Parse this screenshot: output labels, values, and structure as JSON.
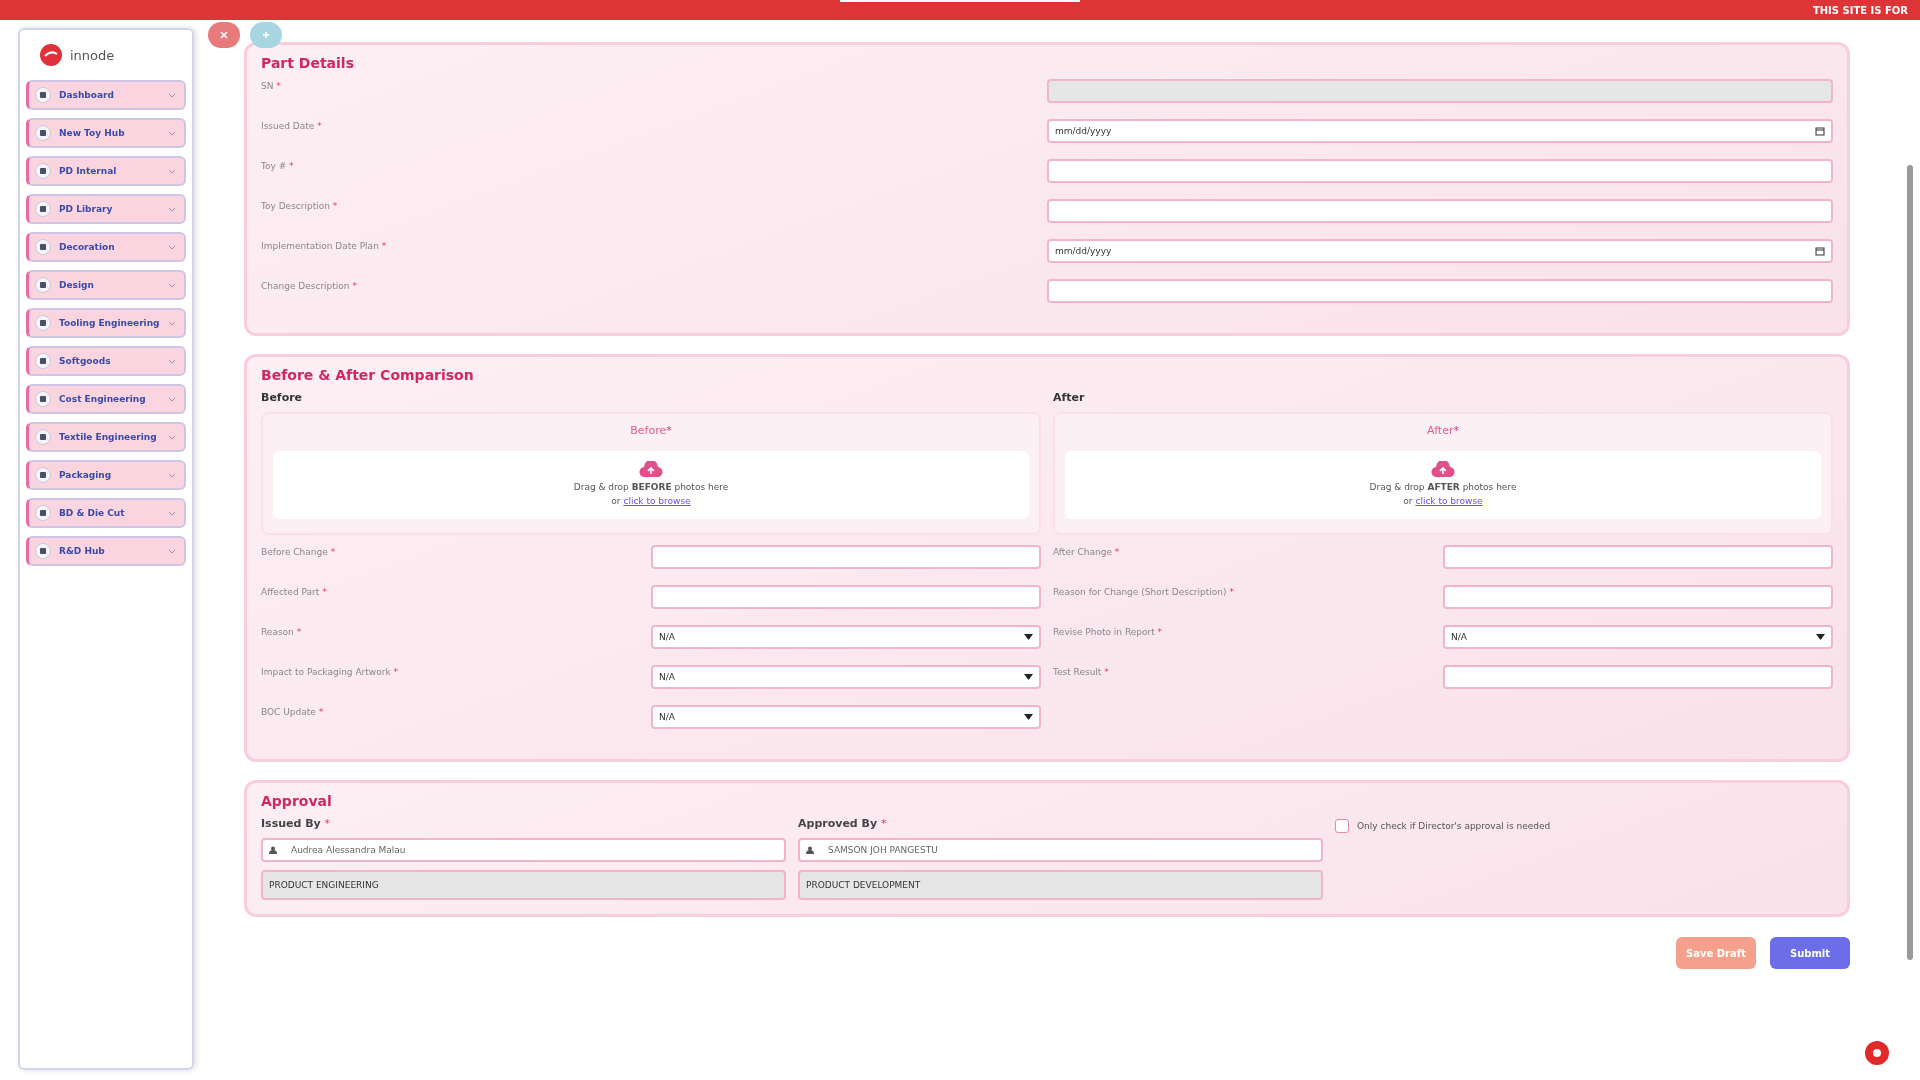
{
  "banner": {
    "text": "THIS SITE IS FOR"
  },
  "logo": {
    "text": "innode"
  },
  "sidebar": {
    "items": [
      {
        "label": "Dashboard"
      },
      {
        "label": "New Toy Hub"
      },
      {
        "label": "PD Internal"
      },
      {
        "label": "PD Library"
      },
      {
        "label": "Decoration"
      },
      {
        "label": "Design"
      },
      {
        "label": "Tooling Engineering"
      },
      {
        "label": "Softgoods"
      },
      {
        "label": "Cost Engineering"
      },
      {
        "label": "Textile Engineering"
      },
      {
        "label": "Packaging"
      },
      {
        "label": "BD & Die Cut"
      },
      {
        "label": "R&D Hub"
      }
    ]
  },
  "part_details": {
    "title": "Part Details",
    "fields": [
      {
        "label": "SN",
        "mark": "*",
        "kind": "readonly"
      },
      {
        "label": "Issued Date",
        "mark": "*",
        "kind": "date",
        "placeholder": "mm/dd/yyyy"
      },
      {
        "label": "Toy #",
        "mark": "*",
        "kind": "text"
      },
      {
        "label": "Toy Description",
        "mark": "*",
        "kind": "text"
      },
      {
        "label": "Implementation Date Plan",
        "mark": "*",
        "kind": "date",
        "placeholder": "mm/dd/yyyy"
      },
      {
        "label": "Change Description",
        "mark": "*",
        "kind": "text"
      }
    ]
  },
  "comparison": {
    "title": "Before & After Comparison",
    "columns": [
      {
        "heading": "Before",
        "upload_title": "Before",
        "mark": "*",
        "drop_text": "Drag & drop **BEFORE** photos here",
        "or_text": "or",
        "browse_link": "click to browse",
        "fields": [
          {
            "label": "Before Change",
            "mark": "*",
            "kind": "text"
          },
          {
            "label": "Affected Part",
            "mark": "*",
            "kind": "text"
          },
          {
            "label": "Reason",
            "mark": "*",
            "kind": "select",
            "value": "N/A"
          },
          {
            "label": "Impact to Packaging Artwork",
            "mark": "*",
            "kind": "select",
            "value": "N/A"
          },
          {
            "label": "BOC Update",
            "mark": "*",
            "kind": "select",
            "value": "N/A"
          }
        ]
      },
      {
        "heading": "After",
        "upload_title": "After",
        "mark": "*",
        "drop_text": "Drag & drop **AFTER** photos here",
        "or_text": "or",
        "browse_link": "click to browse",
        "fields": [
          {
            "label": "After Change",
            "mark": "*",
            "kind": "text"
          },
          {
            "label": "Reason for Change (Short Description)",
            "mark": "*",
            "kind": "text"
          },
          {
            "label": "Revise Photo in Report",
            "mark": "*",
            "kind": "select",
            "value": "N/A"
          },
          {
            "label": "Test Result",
            "mark": "*",
            "kind": "text"
          }
        ]
      }
    ]
  },
  "approval": {
    "title": "Approval",
    "people": [
      {
        "label": "Issued By",
        "mark": "*",
        "value": "Audrea Alessandra Malau",
        "department": "PRODUCT ENGINEERING"
      },
      {
        "label": "Approved By",
        "mark": "*",
        "value": "SAMSON JOH PANGESTU",
        "department": "PRODUCT DEVELOPMENT"
      }
    ],
    "director_check": {
      "label": "Only check if Director's approval is needed",
      "checked": false
    }
  },
  "actions": [
    {
      "label": "Save Draft",
      "kind": "secondary"
    },
    {
      "label": "Submit",
      "kind": "primary"
    }
  ]
}
